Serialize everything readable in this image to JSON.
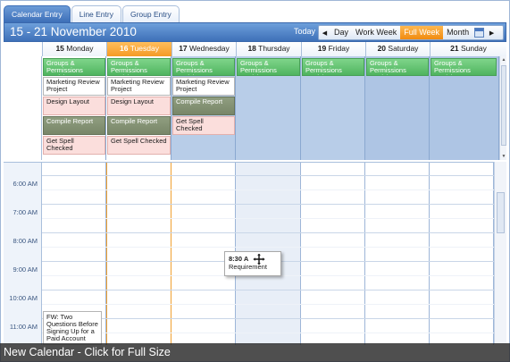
{
  "tabs": [
    "Calendar Entry",
    "Line Entry",
    "Group Entry"
  ],
  "header": {
    "title": "15 - 21 November 2010",
    "today_label": "Today",
    "views": [
      "Day",
      "Work Week",
      "Full Week",
      "Month"
    ],
    "active_view": "Full Week",
    "prev_icon": "chevron-left-icon",
    "next_icon": "chevron-right-icon"
  },
  "days": [
    {
      "num": "15",
      "name": "Monday"
    },
    {
      "num": "16",
      "name": "Tuesday"
    },
    {
      "num": "17",
      "name": "Wednesday"
    },
    {
      "num": "18",
      "name": "Thursday"
    },
    {
      "num": "19",
      "name": "Friday"
    },
    {
      "num": "20",
      "name": "Saturday"
    },
    {
      "num": "21",
      "name": "Sunday"
    }
  ],
  "allday_events": {
    "groups_permissions": "Groups & Permissions Revision",
    "marketing_review": "Marketing Review Project",
    "design_layout": "Design Layout",
    "compile_report": "Compile Report",
    "get_spell_checked": "Get Spell Checked"
  },
  "times": [
    "6:00 AM",
    "7:00 AM",
    "8:00 AM",
    "9:00 AM",
    "10:00 AM",
    "11:00 AM"
  ],
  "drag_card": {
    "time": "8:30 A",
    "title": "Requirement"
  },
  "fw_event": "FW: Two Questions Before Signing Up for a Paid Account",
  "caption": "New Calendar - Click for Full Size",
  "colors": {
    "accent": "#3e70b8",
    "today": "#f59a25",
    "event_green": "#4fb45f",
    "event_pink": "#fbdedc",
    "event_olive": "#788668"
  }
}
